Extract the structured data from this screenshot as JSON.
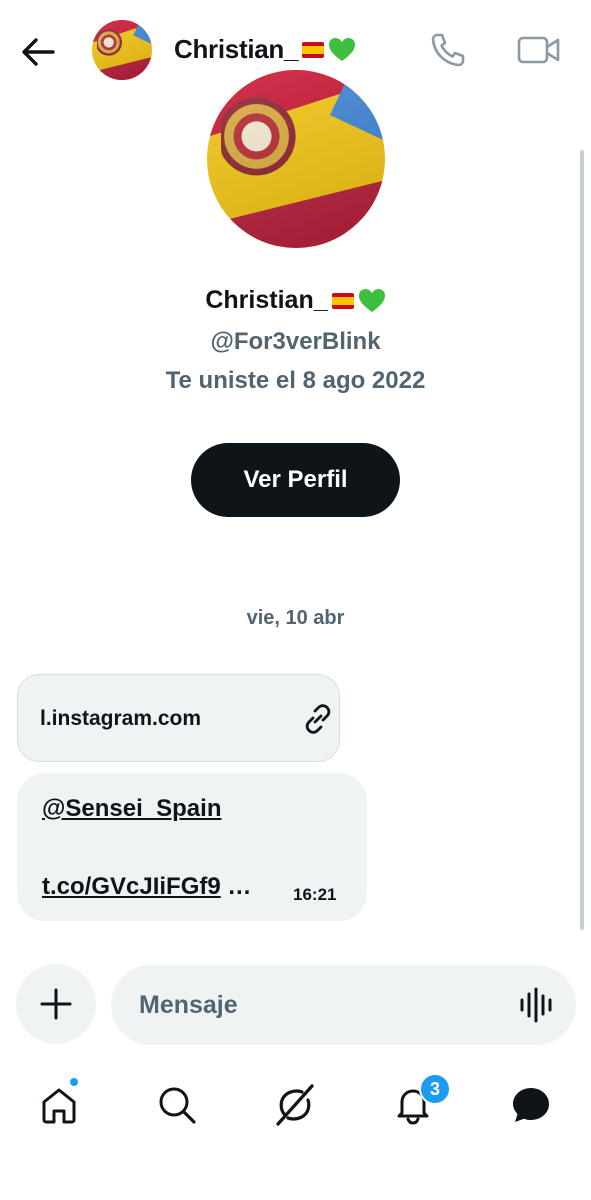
{
  "header": {
    "back_icon": "arrow-left-icon",
    "name": "Christian_",
    "name_emojis": [
      "spain-flag-emoji",
      "green-heart-emoji"
    ],
    "call_icon": "phone-icon",
    "video_icon": "video-camera-icon"
  },
  "profile": {
    "name": "Christian_",
    "handle": "@For3verBlink",
    "joined": "Te uniste el 8 ago 2022",
    "view_profile_label": "Ver Perfil"
  },
  "conversation": {
    "date_separator": "vie, 10 abr",
    "messages": [
      {
        "type": "link-card",
        "domain": "l.instagram.com",
        "icon": "link-icon"
      },
      {
        "type": "text",
        "mention": "@Sensei_Spain",
        "url": "t.co/GVcJIiFGf9",
        "url_suffix": " …",
        "time": "16:21"
      }
    ]
  },
  "composer": {
    "add_icon": "plus-icon",
    "placeholder": "Mensaje",
    "voice_icon": "voice-waveform-icon"
  },
  "bottom_nav": {
    "items": [
      "home-icon",
      "search-icon",
      "grok-icon",
      "bell-icon",
      "messages-icon"
    ],
    "notifications_count": "3"
  },
  "colors": {
    "text_primary": "#0f1419",
    "text_secondary": "#536471",
    "bubble_bg": "#eff3f4",
    "accent": "#1d9bf0",
    "button_dark": "#0f1419"
  }
}
